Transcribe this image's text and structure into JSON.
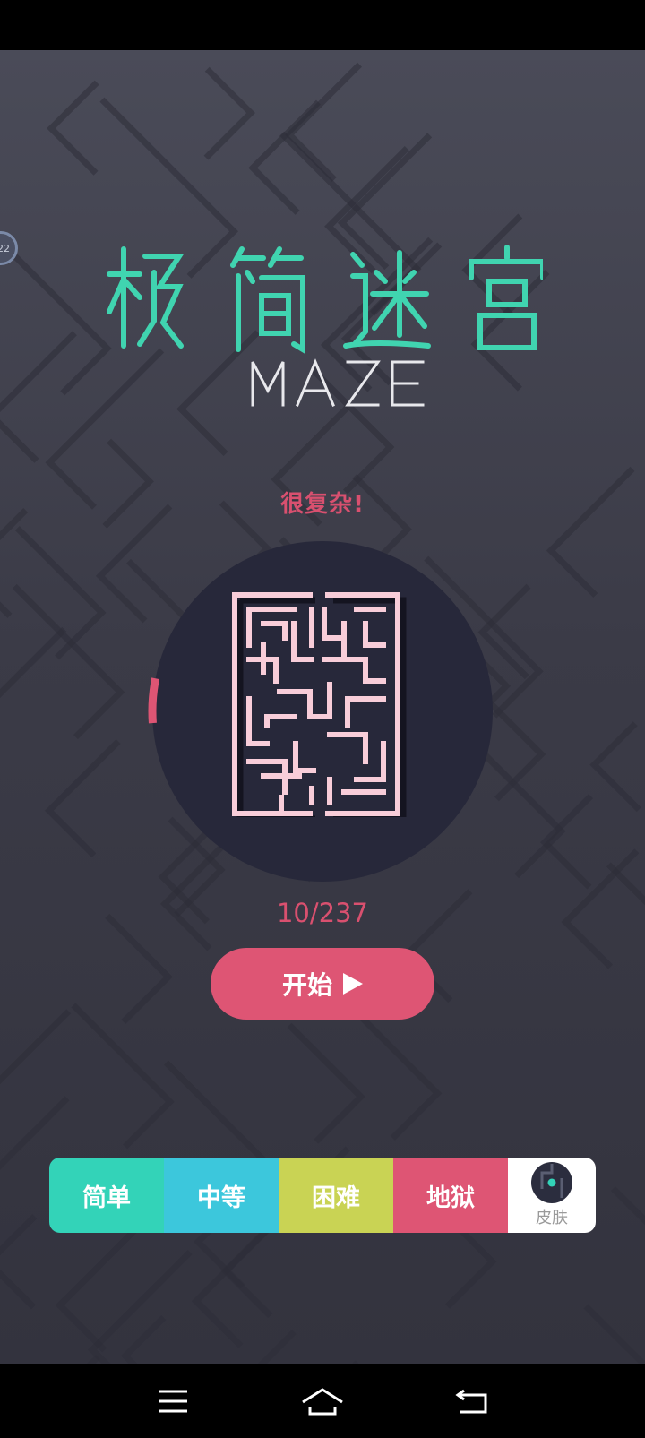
{
  "title": {
    "text": "极简迷宫",
    "subtitle": "MAZE"
  },
  "side_badge": {
    "text": "22"
  },
  "difficulty_comment": "很复杂!",
  "level": {
    "counter": "10/237",
    "progress": 0.042
  },
  "start_button": {
    "label": "开始",
    "icon": "play-icon"
  },
  "difficulties": [
    {
      "label": "简单",
      "color": "#33d3b8"
    },
    {
      "label": "中等",
      "color": "#3cc7dc"
    },
    {
      "label": "困难",
      "color": "#c9d354"
    },
    {
      "label": "地狱",
      "color": "#de5574"
    }
  ],
  "skin": {
    "label": "皮肤",
    "icon": "skin-icon"
  },
  "colors": {
    "accent": "#d9506f",
    "title": "#40d4b0",
    "maze_wall": "#f8cdd9",
    "maze_bg": "#27283a"
  },
  "nav": [
    {
      "icon": "menu-icon"
    },
    {
      "icon": "home-icon"
    },
    {
      "icon": "back-icon"
    }
  ]
}
